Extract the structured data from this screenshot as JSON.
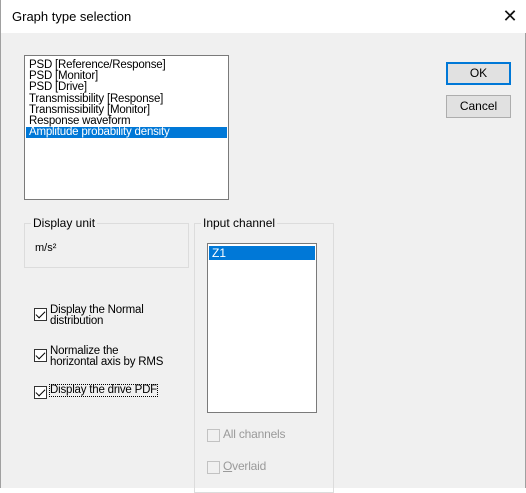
{
  "window": {
    "title": "Graph type selection"
  },
  "graph_types": {
    "items": [
      "PSD [Reference/Response]",
      "PSD [Monitor]",
      "PSD [Drive]",
      "Transmissibility [Response]",
      "Transmissibility [Monitor]",
      "Response waveform",
      "Amplitude probability density"
    ],
    "selected": "Amplitude probability density"
  },
  "buttons": {
    "ok": "OK",
    "cancel": "Cancel"
  },
  "display_unit": {
    "label": "Display unit",
    "value": "m/s²"
  },
  "options": {
    "normal_distribution": {
      "label_line1": "Display the Normal",
      "label_line2": "distribution",
      "checked": true
    },
    "normalize_rms": {
      "label_line1": "Normalize the",
      "label_line2": "horizontal axis by RMS",
      "checked": true
    },
    "drive_pdf": {
      "label": "Display the drive PDF",
      "checked": true
    }
  },
  "input_channel": {
    "label": "Input channel",
    "items": [
      "Z1"
    ],
    "selected": "Z1",
    "all_channels_label": "All channels",
    "overlaid_prefix": "O",
    "overlaid_suffix": "verlaid"
  },
  "icons": {
    "close": "close-icon",
    "check": "checkmark-icon"
  }
}
